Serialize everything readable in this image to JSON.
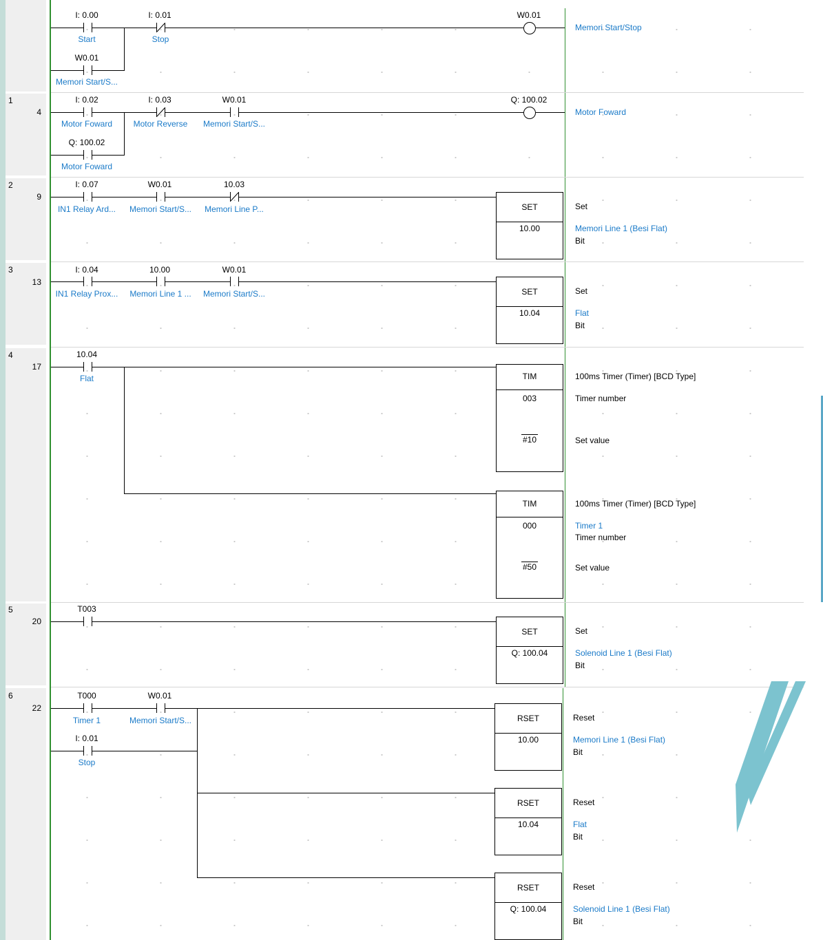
{
  "rungs": [
    {
      "contacts": [
        {
          "addr": "I: 0.00",
          "comment": "Start"
        },
        {
          "addr": "I: 0.01",
          "comment": "Stop"
        },
        {
          "addr": "W0.01",
          "comment": "Memori Start/S..."
        }
      ],
      "coil": {
        "addr": "W0.01"
      },
      "right": {
        "comment": "Memori Start/Stop"
      }
    },
    {
      "num": "1",
      "step": "4",
      "contacts": [
        {
          "addr": "I: 0.02",
          "comment": "Motor Foward"
        },
        {
          "addr": "I: 0.03",
          "comment": "Motor Reverse"
        },
        {
          "addr": "W0.01",
          "comment": "Memori Start/S..."
        },
        {
          "addr": "Q: 100.02",
          "comment": "Motor Foward"
        }
      ],
      "coil": {
        "addr": "Q: 100.02"
      },
      "right": {
        "comment": "Motor Foward"
      }
    },
    {
      "num": "2",
      "step": "9",
      "contacts": [
        {
          "addr": "I: 0.07",
          "comment": "IN1 Relay Ard..."
        },
        {
          "addr": "W0.01",
          "comment": "Memori Start/S..."
        },
        {
          "addr": "10.03",
          "comment": "Memori Line P..."
        }
      ],
      "box": {
        "instr": "SET",
        "operand": "10.00"
      },
      "right": {
        "title": "Set",
        "comment": "Memori Line 1 (Besi Flat)",
        "type": "Bit"
      }
    },
    {
      "num": "3",
      "step": "13",
      "contacts": [
        {
          "addr": "I: 0.04",
          "comment": "IN1 Relay Prox..."
        },
        {
          "addr": "10.00",
          "comment": "Memori Line 1 ..."
        },
        {
          "addr": "W0.01",
          "comment": "Memori Start/S..."
        }
      ],
      "box": {
        "instr": "SET",
        "operand": "10.04"
      },
      "right": {
        "title": "Set",
        "comment": "Flat",
        "type": "Bit"
      }
    },
    {
      "num": "4",
      "step": "17",
      "contacts": [
        {
          "addr": "10.04",
          "comment": "Flat"
        }
      ],
      "timers": [
        {
          "instr": "TIM",
          "num": "003",
          "sv": "#10",
          "title": "100ms Timer (Timer) [BCD Type]",
          "num_label": "Timer number",
          "sv_label": "Set value"
        },
        {
          "instr": "TIM",
          "num": "000",
          "sv": "#50",
          "title": "100ms Timer (Timer) [BCD Type]",
          "comment": "Timer 1",
          "num_label": "Timer number",
          "sv_label": "Set value"
        }
      ]
    },
    {
      "num": "5",
      "step": "20",
      "contacts": [
        {
          "addr": "T003"
        }
      ],
      "box": {
        "instr": "SET",
        "operand": "Q: 100.04"
      },
      "right": {
        "title": "Set",
        "comment": "Solenoid Line 1 (Besi Flat)",
        "type": "Bit"
      }
    },
    {
      "num": "6",
      "step": "22",
      "contacts": [
        {
          "addr": "T000",
          "comment": "Timer 1"
        },
        {
          "addr": "W0.01",
          "comment": "Memori Start/S..."
        },
        {
          "addr": "I: 0.01",
          "comment": "Stop"
        }
      ],
      "resets": [
        {
          "instr": "RSET",
          "operand": "10.00",
          "title": "Reset",
          "comment": "Memori Line 1 (Besi Flat)",
          "type": "Bit"
        },
        {
          "instr": "RSET",
          "operand": "10.04",
          "title": "Reset",
          "comment": "Flat",
          "type": "Bit"
        },
        {
          "instr": "RSET",
          "operand": "Q: 100.04",
          "title": "Reset",
          "comment": "Solenoid Line 1 (Besi Flat)",
          "type": "Bit"
        }
      ]
    }
  ]
}
